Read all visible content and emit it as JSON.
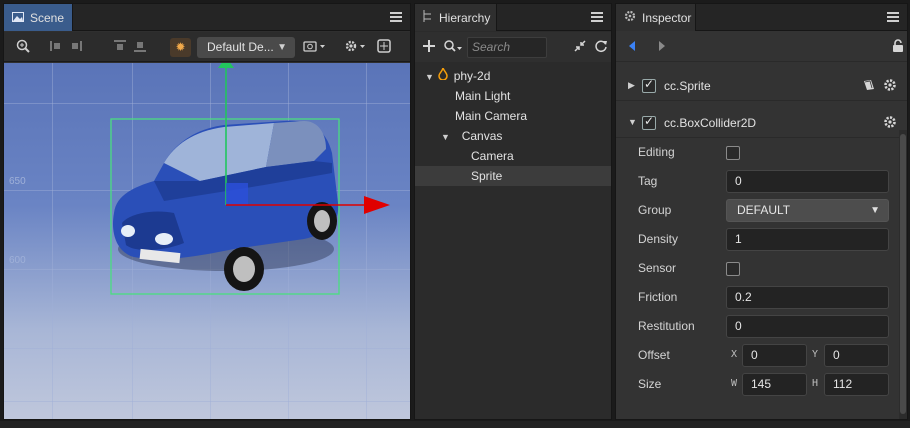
{
  "scene": {
    "tab_label": "Scene",
    "camera_dropdown": "Default De...",
    "y_labels": [
      "650",
      "600"
    ]
  },
  "hierarchy": {
    "tab_label": "Hierarchy",
    "search_placeholder": "Search name,",
    "tree": [
      {
        "label": "phy-2d",
        "depth": 0,
        "expanded": true,
        "root": true
      },
      {
        "label": "Main Light",
        "depth": 1
      },
      {
        "label": "Main Camera",
        "depth": 1
      },
      {
        "label": "Canvas",
        "depth": 1,
        "expanded": true
      },
      {
        "label": "Camera",
        "depth": 2
      },
      {
        "label": "Sprite",
        "depth": 2,
        "selected": true
      }
    ]
  },
  "inspector": {
    "tab_label": "Inspector",
    "components": {
      "sprite": {
        "name": "cc.Sprite",
        "enabled": true
      },
      "collider": {
        "name": "cc.BoxCollider2D",
        "enabled": true
      }
    },
    "props": {
      "editing": {
        "label": "Editing",
        "checked": false
      },
      "tag": {
        "label": "Tag",
        "value": "0"
      },
      "group": {
        "label": "Group",
        "value": "DEFAULT"
      },
      "density": {
        "label": "Density",
        "value": "1"
      },
      "sensor": {
        "label": "Sensor",
        "checked": false
      },
      "friction": {
        "label": "Friction",
        "value": "0.2"
      },
      "restitution": {
        "label": "Restitution",
        "value": "0"
      },
      "offset": {
        "label": "Offset",
        "x_axis": "X",
        "x": "0",
        "y_axis": "Y",
        "y": "0"
      },
      "size": {
        "label": "Size",
        "w_axis": "W",
        "w": "145",
        "h_axis": "H",
        "h": "112"
      }
    }
  },
  "colors": {
    "accent_blue": "#3a5c8c",
    "gizmo_y": "#22c55e",
    "gizmo_x": "#e00000",
    "collider_outline": "#4ade80",
    "car_body": "#2a4fb8",
    "hierarchy_root_icon": "#f59e0b"
  }
}
